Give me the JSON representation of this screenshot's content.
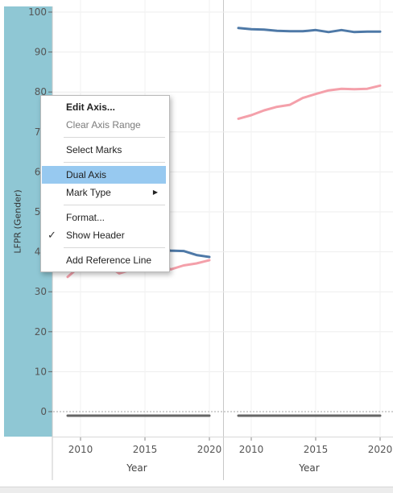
{
  "y_axis": {
    "title": "LFPR (Gender)",
    "ticks": [
      "100",
      "90",
      "80",
      "70",
      "60",
      "50",
      "40",
      "30",
      "20",
      "10",
      "0"
    ]
  },
  "x_axis": {
    "title": "Year",
    "tick_labels": [
      "2010",
      "2015",
      "2020"
    ]
  },
  "context_menu": {
    "edit_axis": "Edit Axis...",
    "clear_axis_range": "Clear Axis Range",
    "select_marks": "Select Marks",
    "dual_axis": "Dual Axis",
    "mark_type": "Mark Type",
    "format": "Format...",
    "show_header": "Show Header",
    "add_reference_line": "Add Reference Line",
    "check_glyph": "✓",
    "submenu_glyph": "▶"
  },
  "chart_data": {
    "type": "line",
    "ylim": [
      0,
      100
    ],
    "ylabel": "LFPR (Gender)",
    "xlabel": "Year",
    "panes": [
      {
        "x": [
          2009,
          2010,
          2011,
          2012,
          2013,
          2014,
          2015,
          2016,
          2017,
          2018,
          2019,
          2020
        ],
        "series": [
          {
            "values": [
              null,
              null,
              null,
              null,
              null,
              null,
              40.7,
              40.5,
              40.3,
              40.2,
              39.2,
              38.7
            ],
            "color": "#4e79a7"
          },
          {
            "values": [
              33.7,
              36.5,
              37.5,
              36.8,
              34.6,
              35.6,
              36.0,
              37.2,
              35.6,
              36.6,
              37.1,
              37.9
            ],
            "color": "#f4a0aa"
          },
          {
            "values": [
              -1,
              -1,
              -1,
              -1,
              -1,
              -1,
              -1,
              -1,
              -1,
              -1,
              -1,
              -1
            ],
            "color": "#666666"
          }
        ]
      },
      {
        "x": [
          2009,
          2010,
          2011,
          2012,
          2013,
          2014,
          2015,
          2016,
          2017,
          2018,
          2019,
          2020
        ],
        "series": [
          {
            "values": [
              96.0,
              95.7,
              95.6,
              95.3,
              95.2,
              95.2,
              95.5,
              95.0,
              95.5,
              95.0,
              95.1,
              95.1
            ],
            "color": "#4e79a7"
          },
          {
            "values": [
              73.3,
              74.2,
              75.4,
              76.3,
              76.8,
              78.5,
              79.5,
              80.4,
              80.8,
              80.7,
              80.8,
              81.6
            ],
            "color": "#f4a0aa"
          },
          {
            "values": [
              -1,
              -1,
              -1,
              -1,
              -1,
              -1,
              -1,
              -1,
              -1,
              -1,
              -1,
              -1
            ],
            "color": "#666666"
          }
        ]
      }
    ]
  }
}
